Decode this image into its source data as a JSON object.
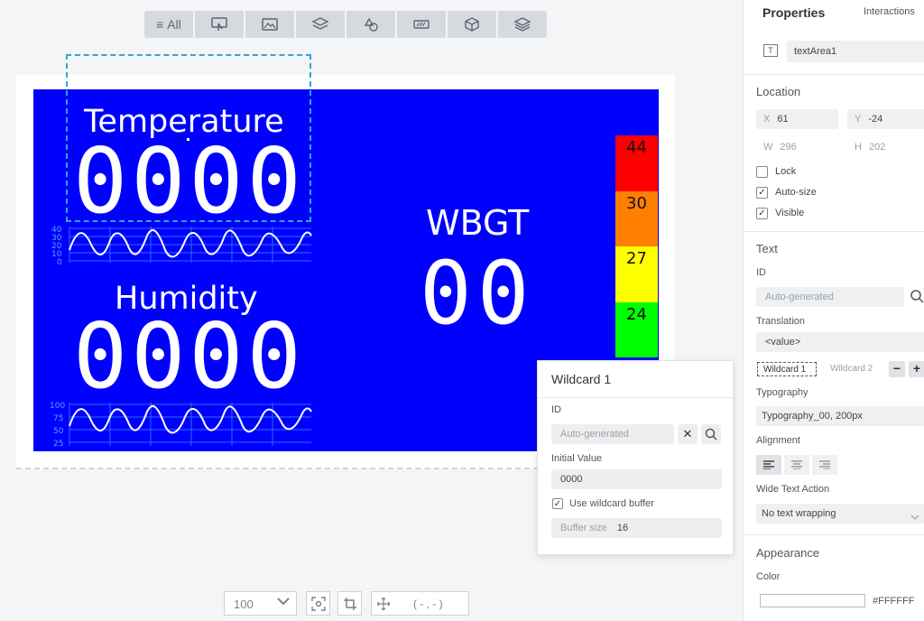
{
  "toolbar": {
    "all_label": "All"
  },
  "lcd": {
    "temperature_title": "Temperature",
    "temperature_value": "0000",
    "humidity_title": "Humidity",
    "humidity_value": "0000",
    "wbgt_title": "WBGT",
    "wbgt_value": "00",
    "temp_axis": [
      "40",
      "30",
      "20",
      "10",
      "0"
    ],
    "hum_axis": [
      "100",
      "75",
      "50",
      "25"
    ],
    "scale": [
      {
        "label": "44",
        "color": "#ff0000"
      },
      {
        "label": "30",
        "color": "#ff7f00"
      },
      {
        "label": "27",
        "color": "#ffff00"
      },
      {
        "label": "24",
        "color": "#00ff00"
      }
    ]
  },
  "wildcard_popup": {
    "title": "Wildcard 1",
    "id_label": "ID",
    "id_placeholder": "Auto-generated",
    "initial_value_label": "Initial Value",
    "initial_value": "0000",
    "use_buffer_label": "Use wildcard buffer",
    "use_buffer_checked": true,
    "buffer_size_label": "Buffer size",
    "buffer_size": "16"
  },
  "bottom_bar": {
    "zoom": "100",
    "coords": "( - , - )"
  },
  "panel": {
    "tab_properties": "Properties",
    "tab_interactions": "Interactions",
    "widget_name": "textArea1",
    "location_head": "Location",
    "x_key": "X",
    "x_val": "61",
    "y_key": "Y",
    "y_val": "-24",
    "w_key": "W",
    "w_val": "296",
    "h_key": "H",
    "h_val": "202",
    "lock_label": "Lock",
    "autosize_label": "Auto-size",
    "visible_label": "Visible",
    "text_head": "Text",
    "id_label": "ID",
    "id_placeholder": "Auto-generated",
    "translation_label": "Translation",
    "translation_value": "<value>",
    "wildcard1": "Wildcard 1",
    "wildcard2": "Wildcard 2",
    "typography_label": "Typography",
    "typography_value": "Typography_00, 200px",
    "alignment_label": "Alignment",
    "wide_text_label": "Wide Text Action",
    "wide_text_value": "No text wrapping",
    "appearance_head": "Appearance",
    "color_label": "Color",
    "color_value": "#FFFFFF"
  },
  "colors": {
    "screen_bg": "#0000ff",
    "selection": "#31a7d8",
    "accent": "#333333"
  }
}
